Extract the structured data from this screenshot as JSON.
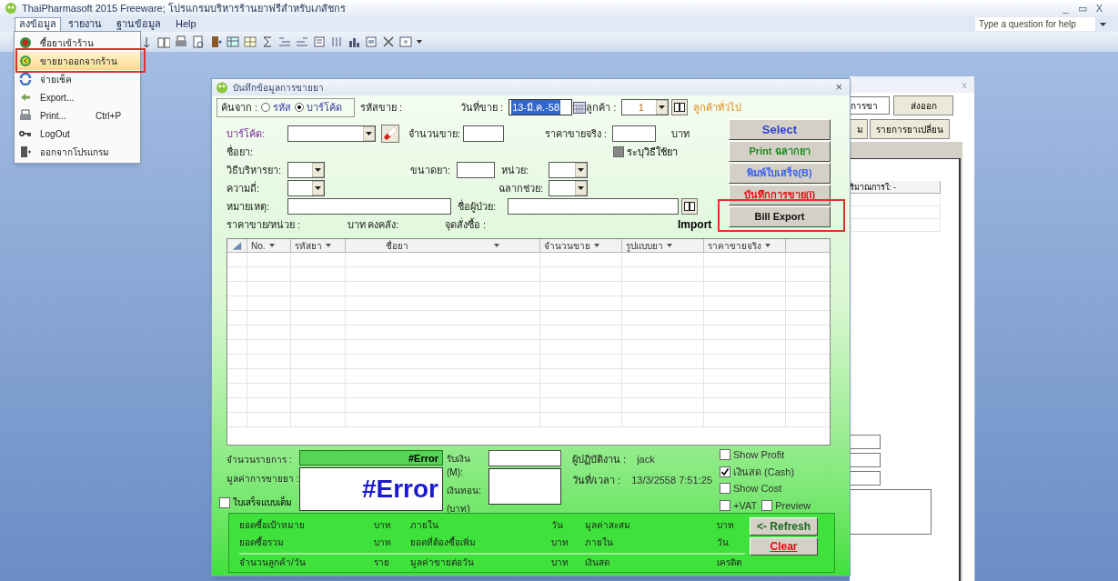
{
  "window": {
    "title": "ThaiPharmasoft 2015 Freeware; โปรแกรมบริหารร้านยาฟรีสำหรับเภสัชกร",
    "controls": [
      "_",
      "▭",
      "X"
    ]
  },
  "menu_bar": [
    {
      "label": "ลงข้อมูล",
      "selected": true
    },
    {
      "label": "รายงาน",
      "selected": false
    },
    {
      "label": "ฐานข้อมูล",
      "selected": false
    },
    {
      "label": "Help",
      "selected": false
    }
  ],
  "help_search": {
    "placeholder": "Type a question for help"
  },
  "dropdown_menu": [
    {
      "label": "ซื้อยาเข้าร้าน",
      "highlighted": false
    },
    {
      "label": "ขายยาออกจากร้าน",
      "highlighted": true
    },
    {
      "label": "จ่ายเช็ค",
      "highlighted": false
    },
    {
      "label": "Export...",
      "highlighted": false
    },
    {
      "label": "Print...",
      "shortcut": "Ctrl+P",
      "highlighted": false
    },
    {
      "label": "LogOut",
      "highlighted": false
    },
    {
      "label": "ออกจากโปรแกรม",
      "highlighted": false
    }
  ],
  "dialog": {
    "title": "บันทึกข้อมูลการขายยา",
    "close": "×",
    "search_by": {
      "label": "ค้นจาก :",
      "options": [
        {
          "label": "รหัส",
          "selected": false
        },
        {
          "label": "บาร์โค้ด",
          "selected": true
        }
      ]
    },
    "sale_code_label": "รหัสขาย :",
    "sale_date": {
      "label": "วันที่ขาย :",
      "value": "13-มี.ค.-58"
    },
    "customer": {
      "label": "ลูกค้า :",
      "value": "1",
      "name": "ลูกค้าทั่วไป"
    },
    "barcode_label": "บาร์โค้ด:",
    "quantity_label": "จำนวนขาย:",
    "actual_price_label": "ราคาขายจริง :",
    "baht_label": "บาท",
    "drug_name_label": "ชื่อยา:",
    "usage_checkbox": {
      "label": "ระบุวิธีใช้ยา",
      "checked": false,
      "disabled": true
    },
    "route_label": "วิธีบริหารยา:",
    "dose_label": "ขนาดยา:",
    "unit_label": "หน่วย:",
    "frequency_label": "ความถี่:",
    "aux_label": "ฉลากช่วย:",
    "note_label": "หมายเหตุ:",
    "patient_label": "ชื่อผู้ป่วย:",
    "unit_price_label": "ราคาขาย/หน่วย :",
    "unit_price_baht": "บาท",
    "stock_label": "คงคลัง:",
    "reorder_label": "จุดสั่งซื้อ :",
    "import_label": "Import",
    "buttons": [
      {
        "label": "Select",
        "color": "#2f3fd0",
        "highlighted": false
      },
      {
        "label": "Print ฉลากยา",
        "color": "#1e8a1e",
        "highlighted": false
      },
      {
        "label": "พิมพ์ใบเสร็จ(B)",
        "color": "#3a5ee8",
        "highlighted": false
      },
      {
        "label": "บันทึกการขาย(I)",
        "color": "#e01010",
        "highlighted": false
      },
      {
        "label": "Bill Export",
        "color": "#111111",
        "highlighted": true
      }
    ],
    "table": {
      "columns": [
        "No.",
        "รหัสยา",
        "ชื่อยา",
        "จำนวนขาย",
        "รูปแบบยา",
        "ราคาขายจริง"
      ]
    },
    "item_count": {
      "label": "จำนวนรายการ :",
      "value": "#Error"
    },
    "sale_value": {
      "label": "มูลค่าการขายยา :",
      "value": "#Error"
    },
    "full_receipt": {
      "label": "ใบเสร็จแบบเต็ม",
      "checked": false
    },
    "received_label": "รับเงิน (M):",
    "change_label": "เงินทอน:",
    "change_unit": "(บาท)",
    "operator": {
      "label": "ผู้ปฏิบัติงาน :",
      "value": "jack"
    },
    "datetime": {
      "label": "วันที่/เวลา :",
      "value": "13/3/2558 7:51:25"
    },
    "options": [
      {
        "label": "Show Profit",
        "checked": false
      },
      {
        "label": "เงินสด (Cash)",
        "checked": true
      },
      {
        "label": "Show Cost",
        "checked": false
      },
      {
        "label": "+VAT",
        "checked": false
      },
      {
        "label": "Preview",
        "checked": false
      }
    ],
    "stats": [
      [
        "ยอดซื้อเป้าหมาย",
        "บาท",
        "ภายใน",
        "วัน",
        "มูลค่าสะสม",
        "บาท"
      ],
      [
        "ยอดซื้อรวม",
        "บาท",
        "ยอดที่ต้องซื้อเพิ่ม",
        "บาท",
        "ภายใน",
        "วัน"
      ],
      [
        "จำนวนลูกค้า/วัน",
        "ราย",
        "มูลค่าขายต่อวัน",
        "บาท",
        "เงินสด",
        "เครดิต"
      ]
    ],
    "side_buttons": [
      {
        "label": "<- Refresh",
        "color": "#1e6a1e"
      },
      {
        "label": "Clear",
        "color": "#e01010"
      }
    ]
  },
  "background_window": {
    "close": "x",
    "field_value": "การขา",
    "buttons": [
      "ส่งออก",
      "ม",
      "รายการยาเปลี่ยน"
    ],
    "column": "ริมาณการใ: -"
  }
}
